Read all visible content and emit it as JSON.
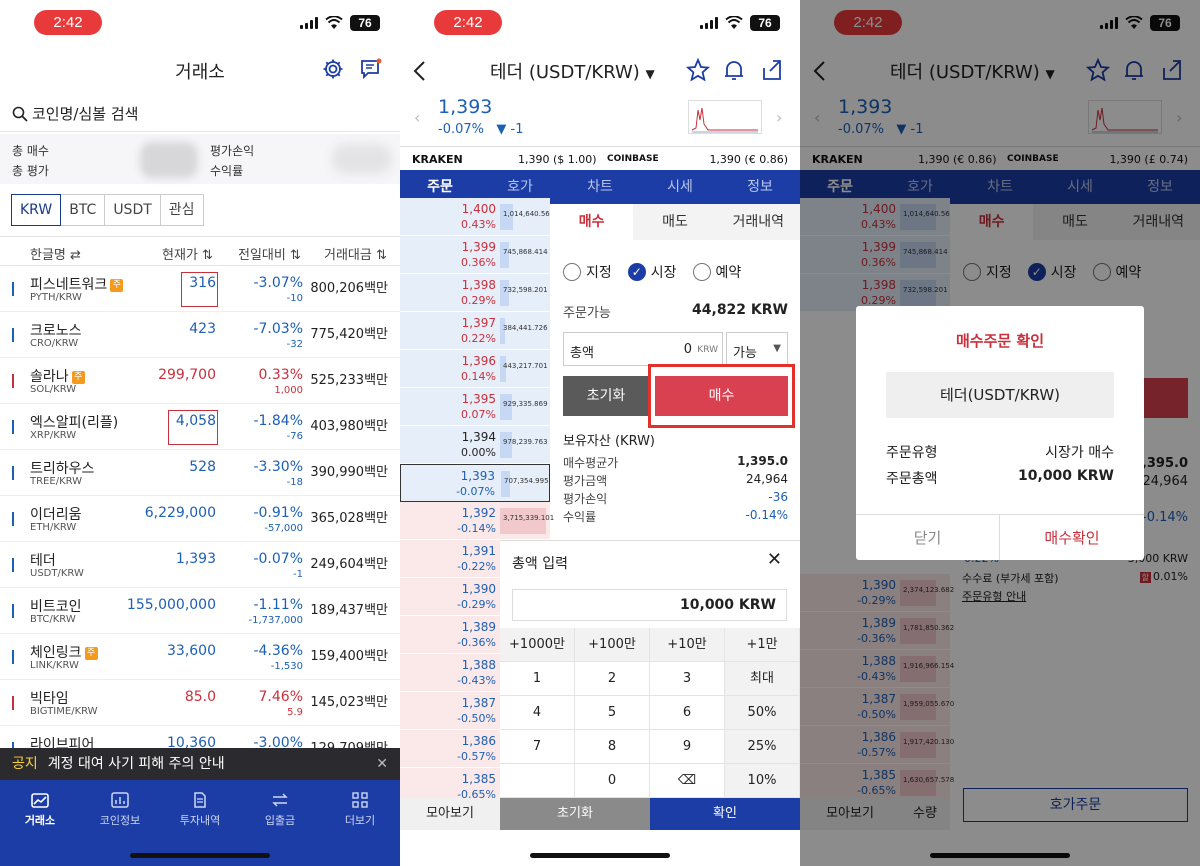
{
  "status": {
    "time": "2:42",
    "battery": "76"
  },
  "p1": {
    "title": "거래소",
    "search_placeholder": "코인명/심볼 검색",
    "summary": {
      "buy": "총 매수",
      "eval": "총 평가",
      "pnl": "평가손익",
      "rate": "수익률"
    },
    "currency_tabs": [
      "KRW",
      "BTC",
      "USDT",
      "관심"
    ],
    "headers": {
      "name": "한글명 ⇄",
      "price": "현재가 ⇅",
      "change": "전일대비 ⇅",
      "volume": "거래대금 ⇅"
    },
    "rows": [
      {
        "name": "피스네트워크",
        "sym": "PYTH/KRW",
        "price": "316",
        "pct": "-3.07%",
        "chg": "-10",
        "vol": "800,206백만",
        "dir": "down",
        "badge": true
      },
      {
        "name": "크로노스",
        "sym": "CRO/KRW",
        "price": "423",
        "pct": "-7.03%",
        "chg": "-32",
        "vol": "775,420백만",
        "dir": "down",
        "badge": false
      },
      {
        "name": "솔라나",
        "sym": "SOL/KRW",
        "price": "299,700",
        "pct": "0.33%",
        "chg": "1,000",
        "vol": "525,233백만",
        "dir": "up",
        "badge": true
      },
      {
        "name": "엑스알피(리플)",
        "sym": "XRP/KRW",
        "price": "4,058",
        "pct": "-1.84%",
        "chg": "-76",
        "vol": "403,980백만",
        "dir": "down",
        "badge": false
      },
      {
        "name": "트리하우스",
        "sym": "TREE/KRW",
        "price": "528",
        "pct": "-3.30%",
        "chg": "-18",
        "vol": "390,990백만",
        "dir": "down",
        "badge": false
      },
      {
        "name": "이더리움",
        "sym": "ETH/KRW",
        "price": "6,229,000",
        "pct": "-0.91%",
        "chg": "-57,000",
        "vol": "365,028백만",
        "dir": "down",
        "badge": false
      },
      {
        "name": "테더",
        "sym": "USDT/KRW",
        "price": "1,393",
        "pct": "-0.07%",
        "chg": "-1",
        "vol": "249,604백만",
        "dir": "down",
        "badge": false
      },
      {
        "name": "비트코인",
        "sym": "BTC/KRW",
        "price": "155,000,000",
        "pct": "-1.11%",
        "chg": "-1,737,000",
        "vol": "189,437백만",
        "dir": "down",
        "badge": false
      },
      {
        "name": "체인링크",
        "sym": "LINK/KRW",
        "price": "33,600",
        "pct": "-4.36%",
        "chg": "-1,530",
        "vol": "159,400백만",
        "dir": "down",
        "badge": true
      },
      {
        "name": "빅타임",
        "sym": "BIGTIME/KRW",
        "price": "85.0",
        "pct": "7.46%",
        "chg": "5.9",
        "vol": "145,023백만",
        "dir": "up",
        "badge": false
      },
      {
        "name": "라이브피어",
        "sym": "",
        "price": "10,360",
        "pct": "-3.00%",
        "chg": "",
        "vol": "129,709백만",
        "dir": "down",
        "badge": false
      }
    ],
    "notice_label": "공지",
    "notice_text": "계정 대여 사기 피해 주의 안내",
    "tabs": [
      "거래소",
      "코인정보",
      "투자내역",
      "입출금",
      "더보기"
    ]
  },
  "p2": {
    "title": "테더 (USDT/KRW)",
    "price": "1,393",
    "pct": "-0.07%",
    "chg": "▼ -1",
    "kraken": "KRAKEN",
    "kraken_val": "1,390 ($ 1.00)",
    "coinbase": "COINBASE",
    "coinbase_val": "1,390 (€ 0.86)",
    "nav": [
      "주문",
      "호가",
      "차트",
      "시세",
      "정보"
    ],
    "orderbook": [
      {
        "p": "1,400",
        "c": "0.43%",
        "q": "1,014,640.563",
        "side": "ask",
        "cls": "red"
      },
      {
        "p": "1,399",
        "c": "0.36%",
        "q": "745,868.414",
        "side": "ask",
        "cls": "red"
      },
      {
        "p": "1,398",
        "c": "0.29%",
        "q": "732,598.201",
        "side": "ask",
        "cls": "red"
      },
      {
        "p": "1,397",
        "c": "0.22%",
        "q": "384,441.726",
        "side": "ask",
        "cls": "red"
      },
      {
        "p": "1,396",
        "c": "0.14%",
        "q": "443,217.701",
        "side": "ask",
        "cls": "red"
      },
      {
        "p": "1,395",
        "c": "0.07%",
        "q": "929,335.869",
        "side": "ask",
        "cls": "red"
      },
      {
        "p": "1,394",
        "c": "0.00%",
        "q": "978,239.763",
        "side": "ask",
        "cls": "black"
      },
      {
        "p": "1,393",
        "c": "-0.07%",
        "q": "707,354.995",
        "side": "ask",
        "cls": "blue"
      },
      {
        "p": "1,392",
        "c": "-0.14%",
        "q": "3,715,339.101",
        "side": "bid",
        "cls": "blue"
      },
      {
        "p": "1,391",
        "c": "-0.22%",
        "q": "",
        "side": "bid",
        "cls": "blue"
      },
      {
        "p": "1,390",
        "c": "-0.29%",
        "q": "",
        "side": "bid",
        "cls": "blue"
      },
      {
        "p": "1,389",
        "c": "-0.36%",
        "q": "",
        "side": "bid",
        "cls": "blue"
      },
      {
        "p": "1,388",
        "c": "-0.43%",
        "q": "",
        "side": "bid",
        "cls": "blue"
      },
      {
        "p": "1,387",
        "c": "-0.50%",
        "q": "",
        "side": "bid",
        "cls": "blue"
      },
      {
        "p": "1,386",
        "c": "-0.57%",
        "q": "",
        "side": "bid",
        "cls": "blue"
      },
      {
        "p": "1,385",
        "c": "-0.65%",
        "q": "",
        "side": "bid",
        "cls": "blue"
      }
    ],
    "order_tabs": [
      "매수",
      "매도",
      "거래내역"
    ],
    "radios": [
      "지정",
      "시장",
      "예약"
    ],
    "avail_label": "주문가능",
    "avail_val": "44,822 KRW",
    "amount_label": "총액",
    "amount_val": "0",
    "amount_unit": "KRW",
    "avail_select": "가능",
    "reset": "초기화",
    "buy": "매수",
    "hold_title": "보유자산 (KRW)",
    "hold": [
      {
        "l": "매수평균가",
        "v": "1,395.0"
      },
      {
        "l": "평가금액",
        "v": "24,964"
      },
      {
        "l": "평가손익",
        "v": "-36"
      },
      {
        "l": "수익률",
        "v": "-0.14%"
      }
    ],
    "sheet_title": "총액 입력",
    "sheet_val": "10,000 KRW",
    "keys": [
      "+1000만",
      "+100만",
      "+10만",
      "+1만",
      "1",
      "2",
      "3",
      "최대",
      "4",
      "5",
      "6",
      "50%",
      "7",
      "8",
      "9",
      "25%",
      "",
      "0",
      "⌫",
      "10%"
    ],
    "bottom": [
      "모아보기",
      "초기화",
      "확인"
    ]
  },
  "p3": {
    "title": "테더 (USDT/KRW)",
    "price": "1,393",
    "pct": "-0.07%",
    "chg": "▼ -1",
    "kraken": "KRAKEN",
    "kraken_val": "1,390 (€ 0.86)",
    "coinbase": "COINBASE",
    "coinbase_val": "1,390 (£ 0.74)",
    "nav": [
      "주문",
      "호가",
      "차트",
      "시세",
      "정보"
    ],
    "order_tabs": [
      "매수",
      "매도",
      "거래내역"
    ],
    "radios": [
      "지정",
      "시장",
      "예약"
    ],
    "orderbook_top": [
      {
        "p": "1,400",
        "c": "0.43%",
        "q": "1,014,640.563"
      },
      {
        "p": "1,399",
        "c": "0.36%",
        "q": "745,868.414"
      },
      {
        "p": "1,398",
        "c": "0.29%",
        "q": "732,598.201"
      }
    ],
    "orderbook_bot": [
      {
        "p": "1,390",
        "c": "-0.29%",
        "q": "2,374,123.682"
      },
      {
        "p": "1,389",
        "c": "-0.36%",
        "q": "1,781,850.362"
      },
      {
        "p": "1,388",
        "c": "-0.43%",
        "q": "1,916,966.154"
      },
      {
        "p": "1,387",
        "c": "-0.50%",
        "q": "1,959,055.670"
      },
      {
        "p": "1,386",
        "c": "-0.57%",
        "q": "1,917,420.130"
      },
      {
        "p": "1,385",
        "c": "-0.65%",
        "q": "1,630,657.578"
      }
    ],
    "peek": [
      "1,395.0",
      "24,964",
      "-0.14%",
      "-0.22%"
    ],
    "fee_label": "수수료 (부가세 포함)",
    "fee_val": "0.01%",
    "order_type_link": "주문유형 안내",
    "order_label_top": "3,000 KRW",
    "modal": {
      "title": "매수주문 확인",
      "name": "테더(USDT/KRW)",
      "type_l": "주문유형",
      "type_v": "시장가 매수",
      "total_l": "주문총액",
      "total_v": "10,000 KRW",
      "close": "닫기",
      "confirm": "매수확인"
    },
    "hoga_btn": "호가주문",
    "bottom": [
      "모아보기",
      "수량"
    ]
  }
}
